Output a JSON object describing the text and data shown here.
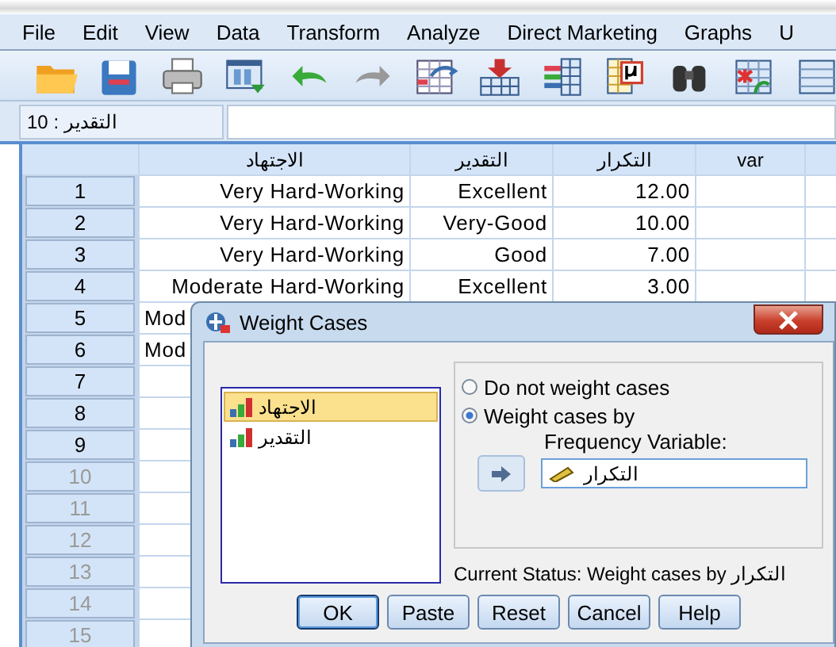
{
  "menu": [
    "File",
    "Edit",
    "View",
    "Data",
    "Transform",
    "Analyze",
    "Direct Marketing",
    "Graphs",
    "U"
  ],
  "toolbar": [
    {
      "kind": "folder"
    },
    {
      "kind": "save"
    },
    {
      "kind": "print"
    },
    {
      "kind": "recall"
    },
    {
      "kind": "undo"
    },
    {
      "kind": "redo"
    },
    {
      "kind": "goto"
    },
    {
      "kind": "insert-case"
    },
    {
      "kind": "insert-variable"
    },
    {
      "kind": "labels"
    },
    {
      "kind": "find"
    },
    {
      "kind": "split"
    },
    {
      "kind": "table"
    }
  ],
  "cell_editor": {
    "label": "التقدير : 10"
  },
  "grid": {
    "columns": [
      "الاجتهاد",
      "التقدير",
      "التكرار",
      "var"
    ],
    "rows": [
      {
        "number": "1",
        "dimmed": false,
        "cells": [
          "Very Hard-Working",
          "Excellent",
          "12.00"
        ]
      },
      {
        "number": "2",
        "dimmed": false,
        "cells": [
          "Very Hard-Working",
          "Very-Good",
          "10.00"
        ]
      },
      {
        "number": "3",
        "dimmed": false,
        "cells": [
          "Very Hard-Working",
          "Good",
          "7.00"
        ]
      },
      {
        "number": "4",
        "dimmed": false,
        "cells": [
          "Moderate Hard-Working",
          "Excellent",
          "3.00"
        ]
      },
      {
        "number": "5",
        "dimmed": false,
        "cells": [
          "Mod"
        ]
      },
      {
        "number": "6",
        "dimmed": false,
        "cells": [
          "Mod"
        ]
      },
      {
        "number": "7",
        "dimmed": false,
        "cells": []
      },
      {
        "number": "8",
        "dimmed": false,
        "cells": []
      },
      {
        "number": "9",
        "dimmed": false,
        "cells": []
      },
      {
        "number": "10",
        "dimmed": true,
        "cells": []
      },
      {
        "number": "11",
        "dimmed": true,
        "cells": []
      },
      {
        "number": "12",
        "dimmed": true,
        "cells": []
      },
      {
        "number": "13",
        "dimmed": true,
        "cells": []
      },
      {
        "number": "14",
        "dimmed": true,
        "cells": []
      },
      {
        "number": "15",
        "dimmed": true,
        "cells": []
      }
    ]
  },
  "dialog": {
    "title": "Weight Cases",
    "variables": [
      {
        "name": "الاجتهاد",
        "selected": true
      },
      {
        "name": "التقدير",
        "selected": false
      }
    ],
    "options": [
      {
        "label": "Do not weight cases",
        "selected": false
      },
      {
        "label": "Weight cases by",
        "selected": true
      }
    ],
    "frequency_label": "Frequency Variable:",
    "frequency_value": "التكرار",
    "status": "Current Status: Weight cases by التكرار",
    "buttons": [
      {
        "label": "OK",
        "default": true
      },
      {
        "label": "Paste",
        "default": false
      },
      {
        "label": "Reset",
        "default": false
      },
      {
        "label": "Cancel",
        "default": false
      },
      {
        "label": "Help",
        "default": false
      }
    ]
  }
}
